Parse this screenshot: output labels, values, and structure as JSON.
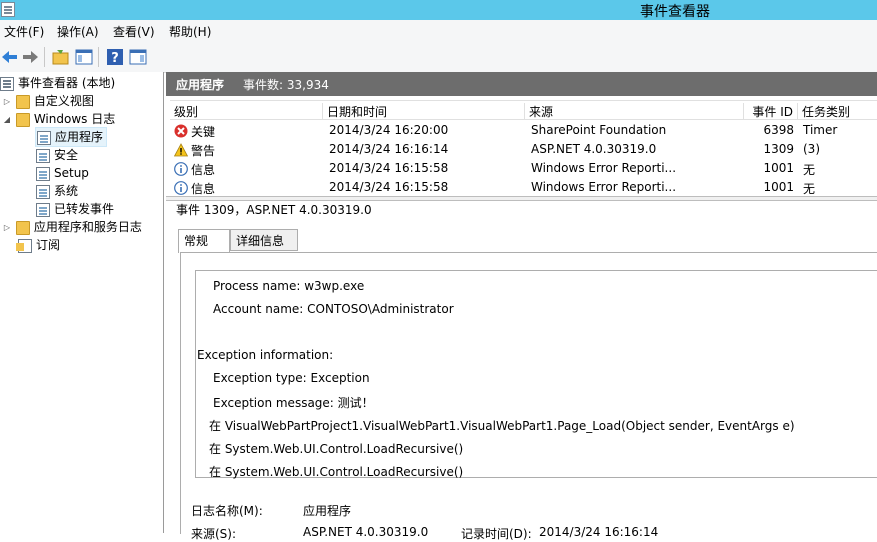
{
  "window": {
    "title": "事件查看器"
  },
  "menu": [
    "文件(F)",
    "操作(A)",
    "查看(V)",
    "帮助(H)"
  ],
  "tree": {
    "root": "事件查看器 (本地)",
    "custom_views": "自定义视图",
    "windows_logs": "Windows 日志",
    "logs": [
      "应用程序",
      "安全",
      "Setup",
      "系统",
      "已转发事件"
    ],
    "app_service_logs": "应用程序和服务日志",
    "subscriptions": "订阅"
  },
  "list": {
    "title": "应用程序",
    "count": "事件数: 33,934",
    "columns": [
      "级别",
      "日期和时间",
      "来源",
      "事件 ID",
      "任务类别"
    ],
    "rows": [
      {
        "level": "关键",
        "level_icon": "critical-icon",
        "datetime": "2014/3/24 16:20:00",
        "source": "SharePoint Foundation",
        "event_id": "6398",
        "task": "Timer"
      },
      {
        "level": "警告",
        "level_icon": "warning-icon",
        "datetime": "2014/3/24 16:16:14",
        "source": "ASP.NET 4.0.30319.0",
        "event_id": "1309",
        "task": "(3)"
      },
      {
        "level": "信息",
        "level_icon": "info-icon",
        "datetime": "2014/3/24 16:15:58",
        "source": "Windows Error Reporti...",
        "event_id": "1001",
        "task": "无"
      },
      {
        "level": "信息",
        "level_icon": "info-icon",
        "datetime": "2014/3/24 16:15:58",
        "source": "Windows Error Reporti...",
        "event_id": "1001",
        "task": "无"
      }
    ]
  },
  "detail": {
    "title": "事件 1309，ASP.NET 4.0.30319.0",
    "tabs": [
      "常规",
      "详细信息"
    ],
    "message_lines": [
      "Process name: w3wp.exe",
      "Account name: CONTOSO\\Administrator",
      "Exception information:",
      "Exception type: Exception",
      "Exception message: 测试！",
      "在 VisualWebPartProject1.VisualWebPart1.VisualWebPart1.Page_Load(Object sender, EventArgs e)",
      "在 System.Web.UI.Control.LoadRecursive()",
      "在 System.Web.UI.Control.LoadRecursive()"
    ],
    "log_name_label": "日志名称(M):",
    "log_name_value": "应用程序",
    "source_label": "来源(S):",
    "source_value": "ASP.NET 4.0.30319.0",
    "logged_label": "记录时间(D):",
    "logged_value": "2014/3/24 16:16:14"
  },
  "colors": {
    "titlebar": "#5bc8ea",
    "header": "#6d6d6d",
    "selection": "#e5f3fb",
    "critical": "#d9302c",
    "warning": "#f4c31b",
    "info": "#3a6fb5"
  }
}
